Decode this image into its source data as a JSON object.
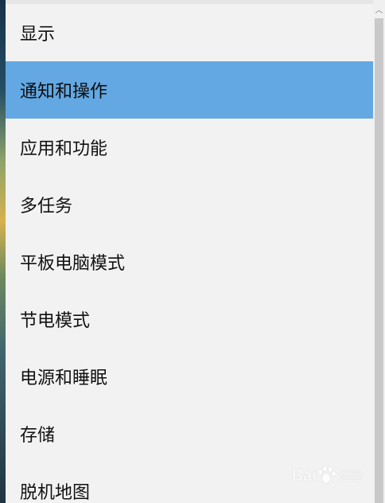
{
  "nav": {
    "items": [
      {
        "label": "显示",
        "selected": false
      },
      {
        "label": "通知和操作",
        "selected": true
      },
      {
        "label": "应用和功能",
        "selected": false
      },
      {
        "label": "多任务",
        "selected": false
      },
      {
        "label": "平板电脑模式",
        "selected": false
      },
      {
        "label": "节电模式",
        "selected": false
      },
      {
        "label": "电源和睡眠",
        "selected": false
      },
      {
        "label": "存储",
        "selected": false
      },
      {
        "label": "脱机地图",
        "selected": false
      }
    ]
  },
  "scrollbar": {
    "up_icon": "chevron-up-icon"
  },
  "watermark": {
    "logo": "Bai",
    "suffix": "经验"
  },
  "colors": {
    "background": "#f2f2f2",
    "selected": "#63a8e2",
    "text": "#111111"
  }
}
